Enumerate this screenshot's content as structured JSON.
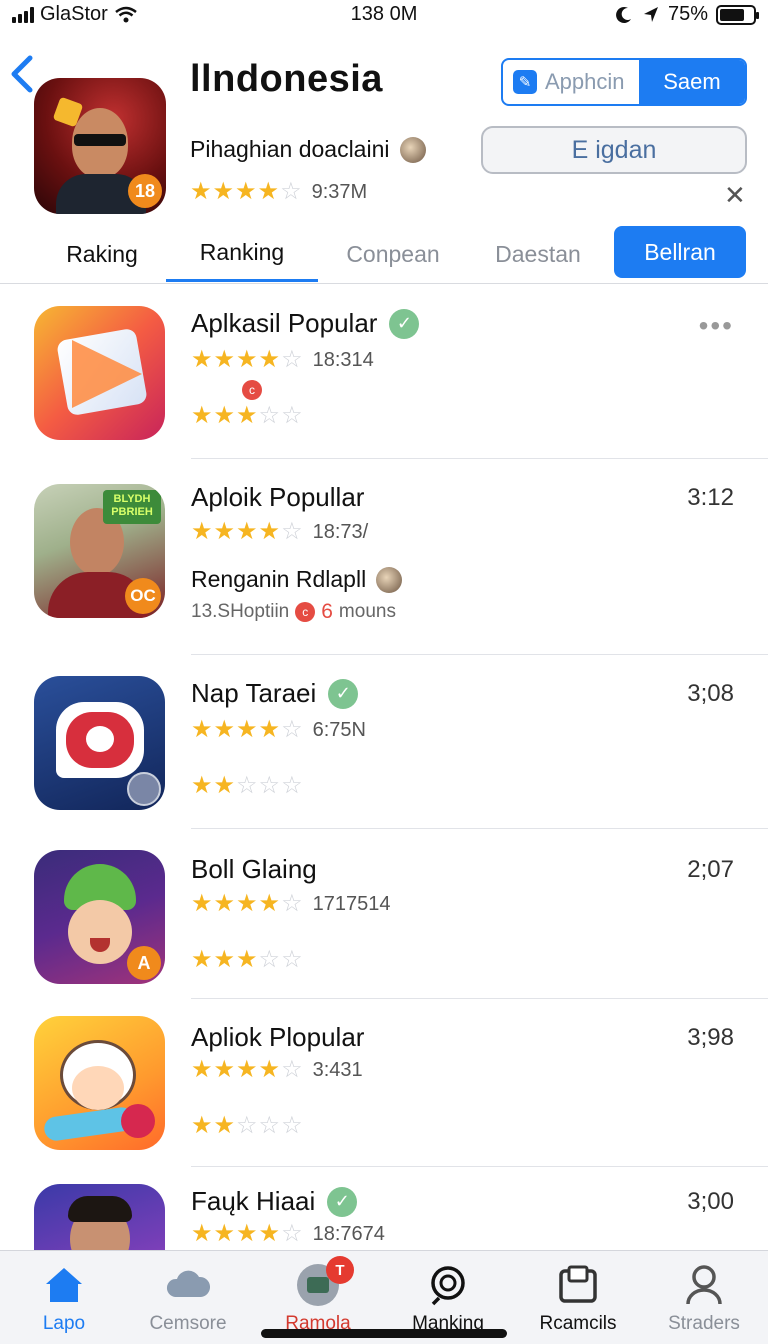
{
  "status": {
    "carrier": "GlaStor",
    "time": "138 0M",
    "battery": "75%"
  },
  "header": {
    "title": "llndonesia",
    "subtitle": "Pihaghian doaclaini",
    "rating_value": "9:37M",
    "hero_stars": 4,
    "seg_left": "Apphcin",
    "seg_right": "Saem",
    "get_label": "E igdan",
    "hero_badge": "18"
  },
  "tabs": [
    "Raking",
    "Ranking",
    "Conpean",
    "Daestan",
    "Bellran"
  ],
  "list": [
    {
      "name": "Aplkasil Popular",
      "time": "",
      "count": "18:314",
      "stars1": 4,
      "stars2": 3,
      "verified": true
    },
    {
      "name": "Aploik Popullar",
      "time": "3:12",
      "count": "18:73/",
      "stars1": 4,
      "sub": "Renganin Rdlapll",
      "meta": "13.SHoptiin",
      "meta_badge": "6",
      "meta_tail": "mouns",
      "icon_label": "BLYDH PBRIEH",
      "icon_badge": "OC"
    },
    {
      "name": "Nap Taraei",
      "time": "3;08",
      "count": "6:75N",
      "stars1": 4,
      "stars2": 2,
      "verified": true
    },
    {
      "name": "Boll Glaing",
      "time": "2;07",
      "count": "1717514",
      "stars1": 4,
      "stars2": 3,
      "icon_badge": "A"
    },
    {
      "name": "Apliok Plopular",
      "time": "3;98",
      "count": "3:431",
      "stars1": 4,
      "stars2": 2
    },
    {
      "name": "Faųk Hiaai",
      "time": "3;00",
      "count": "18:7674",
      "stars1": 4,
      "verified": true
    }
  ],
  "bottom_nav": [
    {
      "label": "Lapo",
      "icon": "home-icon"
    },
    {
      "label": "Cemsore",
      "icon": "cloud-icon"
    },
    {
      "label": "Ramola",
      "icon": "inbox-icon",
      "badge": "T"
    },
    {
      "label": "Manking",
      "icon": "search-icon"
    },
    {
      "label": "Rcamcils",
      "icon": "inbox-icon"
    },
    {
      "label": "Straders",
      "icon": "person-icon"
    }
  ],
  "colors": {
    "accent": "#1d7cf2",
    "star": "#f6b521",
    "verified": "#7ec491",
    "badge_red": "#e53a30"
  }
}
